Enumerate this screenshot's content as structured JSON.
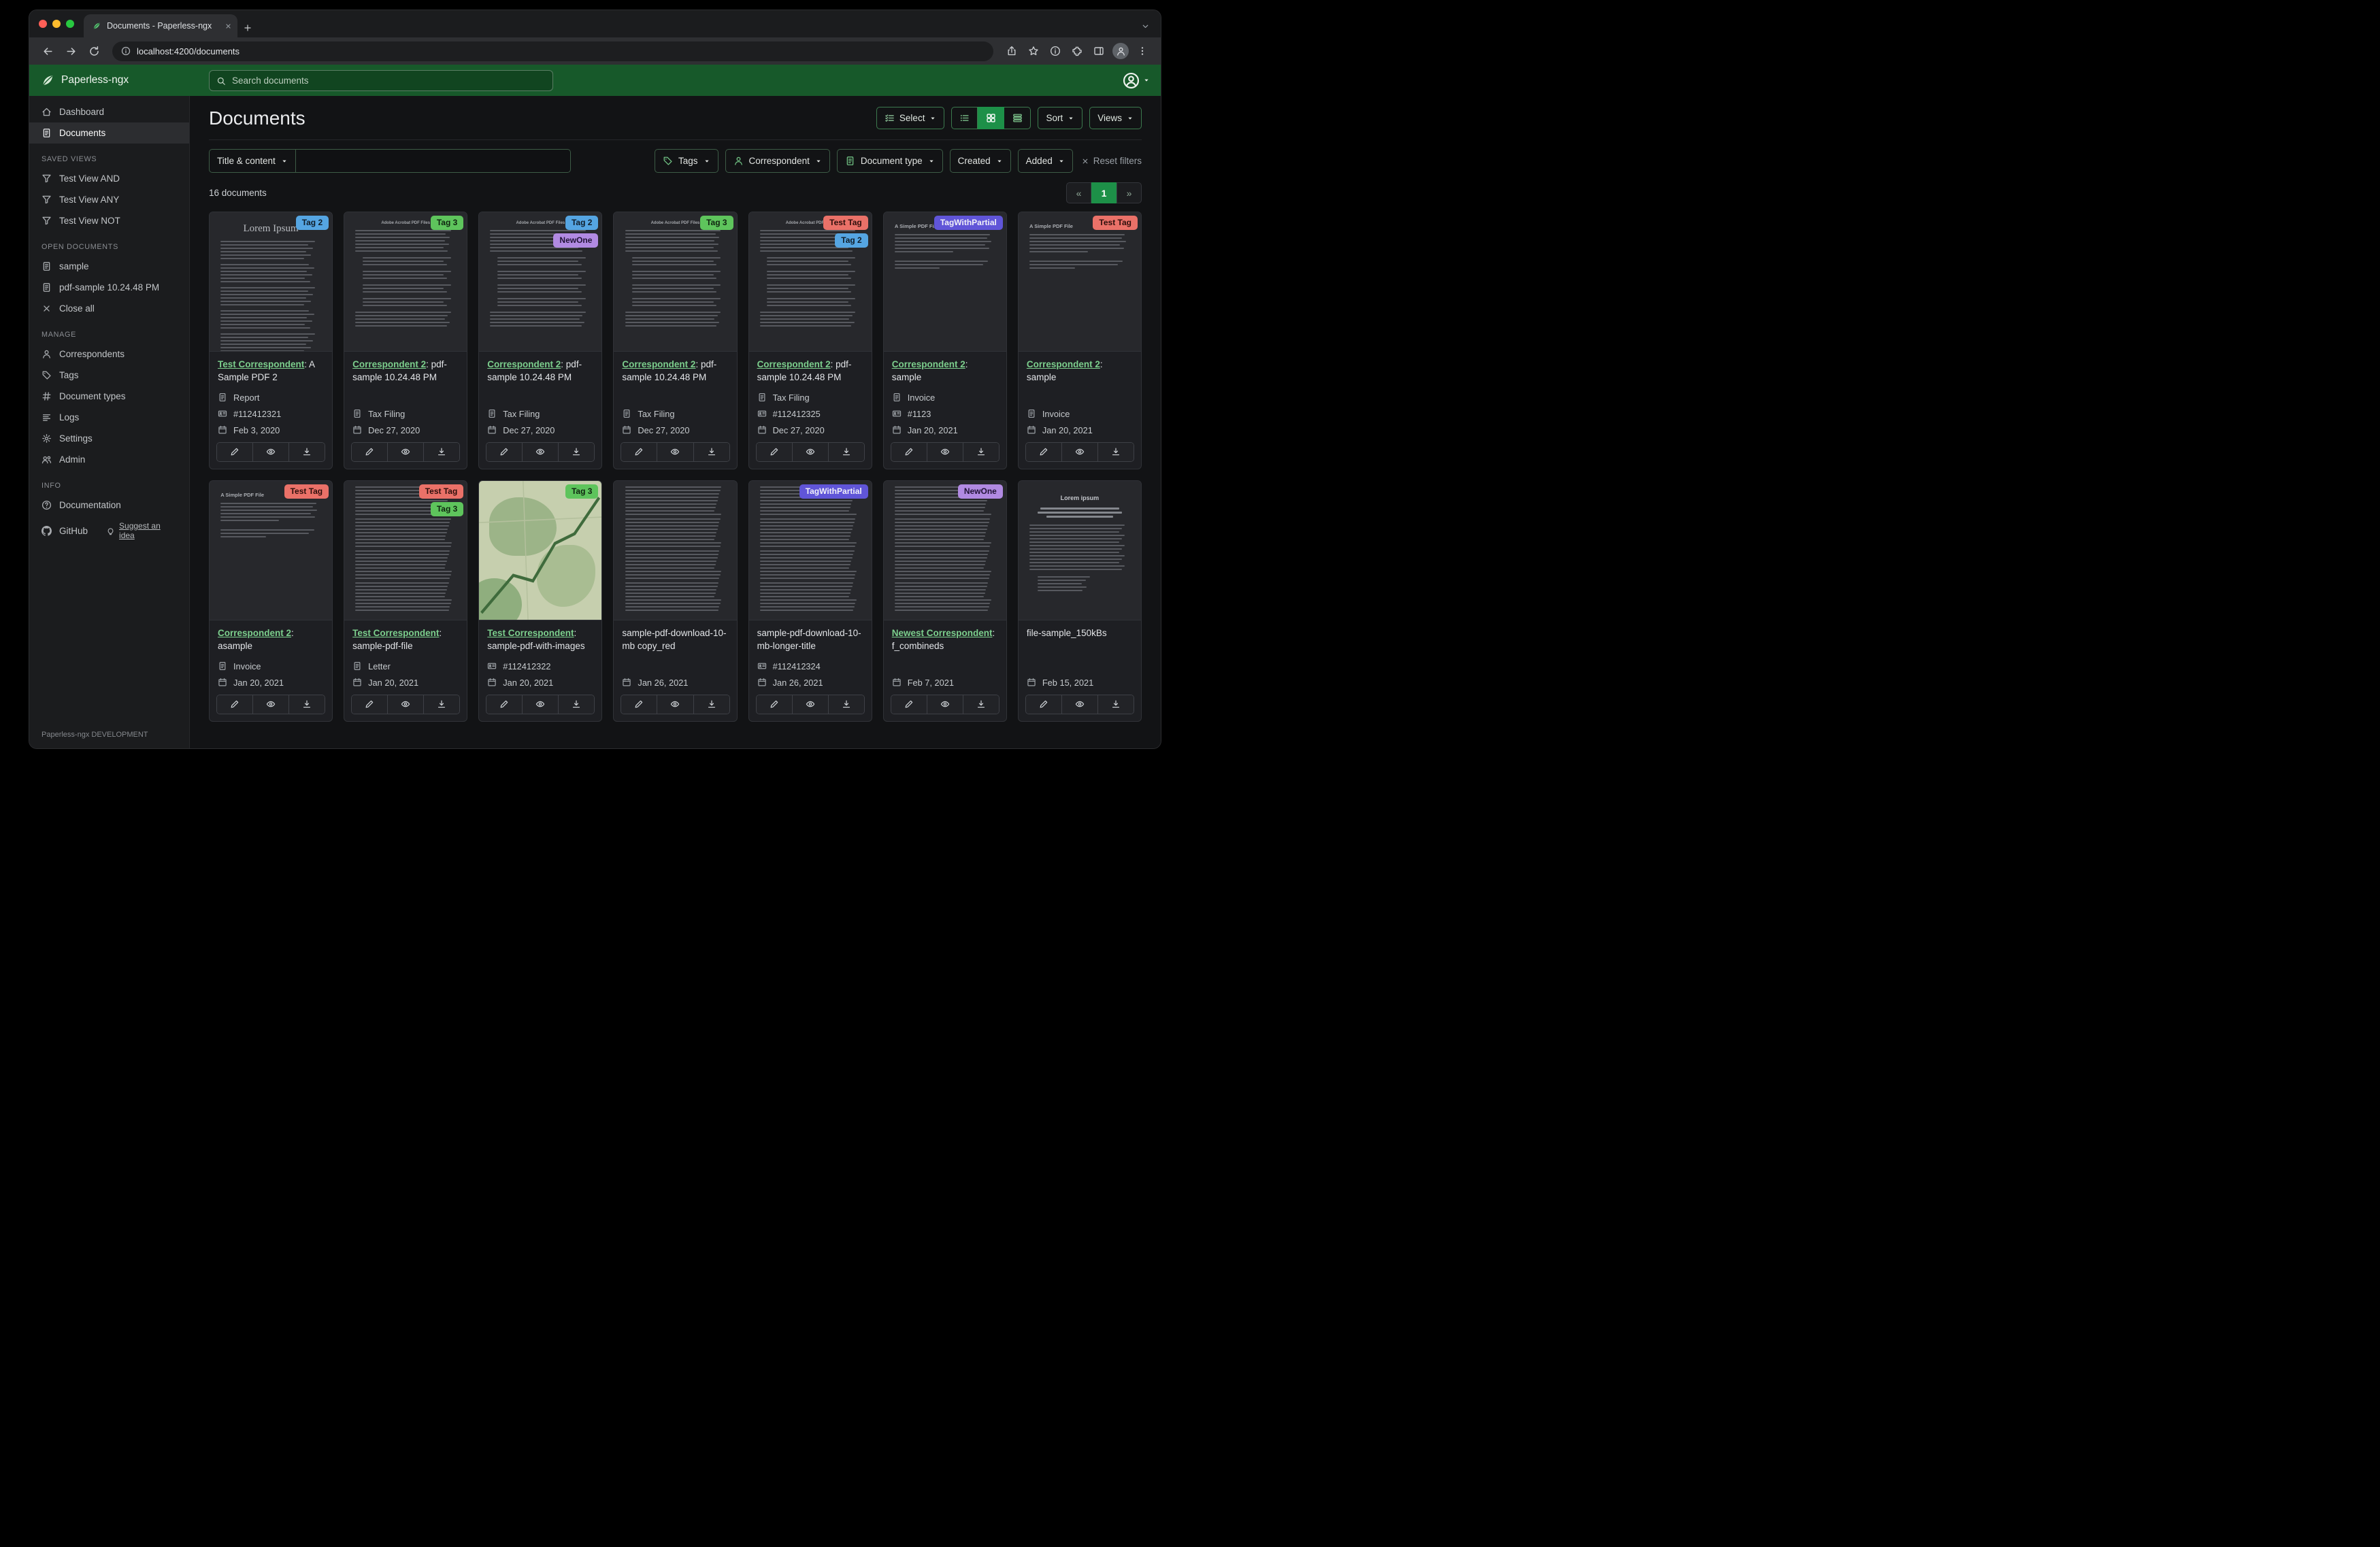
{
  "colors": {
    "header_green": "#17592a",
    "accent_green": "#1d9048",
    "link_green": "#7ccf8d",
    "main_bg": "#121315",
    "sidebar_bg": "#1b1c1e",
    "card_bg": "#1e1f23"
  },
  "browser": {
    "tab_title": "Documents - Paperless-ngx",
    "url": "localhost:4200/documents"
  },
  "header": {
    "brand": "Paperless-ngx",
    "search_placeholder": "Search documents"
  },
  "sidebar": {
    "sections": [
      {
        "items": [
          {
            "icon": "house",
            "label": "Dashboard"
          },
          {
            "icon": "doc",
            "label": "Documents",
            "active": true
          }
        ]
      },
      {
        "header": "SAVED VIEWS",
        "items": [
          {
            "icon": "funnel",
            "label": "Test View AND"
          },
          {
            "icon": "funnel",
            "label": "Test View ANY"
          },
          {
            "icon": "funnel",
            "label": "Test View NOT"
          }
        ]
      },
      {
        "header": "OPEN DOCUMENTS",
        "items": [
          {
            "icon": "doc",
            "label": "sample"
          },
          {
            "icon": "doc",
            "label": "pdf-sample 10.24.48 PM"
          },
          {
            "icon": "x",
            "label": "Close all"
          }
        ]
      },
      {
        "header": "MANAGE",
        "items": [
          {
            "icon": "person",
            "label": "Correspondents"
          },
          {
            "icon": "tag",
            "label": "Tags"
          },
          {
            "icon": "hash",
            "label": "Document types"
          },
          {
            "icon": "logs",
            "label": "Logs"
          },
          {
            "icon": "gear",
            "label": "Settings"
          },
          {
            "icon": "people",
            "label": "Admin"
          }
        ]
      },
      {
        "header": "INFO",
        "items": [
          {
            "icon": "question",
            "label": "Documentation"
          },
          {
            "icon": "github",
            "label": "GitHub",
            "suffix": {
              "icon": "bulb",
              "label": "Suggest an idea"
            }
          }
        ]
      }
    ],
    "footer": "Paperless-ngx DEVELOPMENT"
  },
  "page": {
    "title": "Documents",
    "select_label": "Select",
    "sort_label": "Sort",
    "views_label": "Views",
    "count_label": "16 documents",
    "pagination": {
      "prev": "«",
      "page": "1",
      "next": "»"
    }
  },
  "filters": {
    "title_content_label": "Title & content",
    "query_value": "",
    "buttons": [
      {
        "icon": "tag",
        "label": "Tags"
      },
      {
        "icon": "person",
        "label": "Correspondent"
      },
      {
        "icon": "doc",
        "label": "Document type"
      },
      {
        "label": "Created"
      },
      {
        "label": "Added"
      }
    ],
    "reset_label": "Reset filters"
  },
  "tag_colors": {
    "Tag 2": {
      "bg": "#55a5e2",
      "fg": "#101d29"
    },
    "Tag 3": {
      "bg": "#5ec45c",
      "fg": "#0f2410"
    },
    "NewOne": {
      "bg": "#b18ae2",
      "fg": "#201336"
    },
    "Test Tag": {
      "bg": "#ea7168",
      "fg": "#2d0f0c"
    },
    "TagWithPartial": {
      "bg": "#6055d8",
      "fg": "#f1f1f8"
    }
  },
  "card_actions": [
    "edit",
    "preview",
    "download"
  ],
  "cards": [
    {
      "tags": [
        "Tag 2"
      ],
      "thumb": {
        "variant": "title-doc",
        "heading": "Lorem Ipsum"
      },
      "link": "Test Correspondent",
      "rest": ": A Sample PDF 2",
      "type": "Report",
      "asn": "#112412321",
      "date": "Feb 3, 2020"
    },
    {
      "tags": [
        "Tag 3"
      ],
      "thumb": {
        "variant": "pdf-doc",
        "heading": "Adobe Acrobat PDF Files"
      },
      "link": "Correspondent 2",
      "rest": ": pdf-sample 10.24.48 PM",
      "type": "Tax Filing",
      "date": "Dec 27, 2020"
    },
    {
      "tags": [
        "Tag 2",
        "NewOne"
      ],
      "thumb": {
        "variant": "pdf-doc",
        "heading": "Adobe Acrobat PDF Files"
      },
      "link": "Correspondent 2",
      "rest": ": pdf-sample 10.24.48 PM",
      "type": "Tax Filing",
      "date": "Dec 27, 2020"
    },
    {
      "tags": [
        "Tag 3"
      ],
      "thumb": {
        "variant": "pdf-doc",
        "heading": "Adobe Acrobat PDF Files"
      },
      "link": "Correspondent 2",
      "rest": ": pdf-sample 10.24.48 PM",
      "type": "Tax Filing",
      "date": "Dec 27, 2020"
    },
    {
      "tags": [
        "Test Tag",
        "Tag 2"
      ],
      "thumb": {
        "variant": "pdf-doc",
        "heading": "Adobe Acrobat PDF Files"
      },
      "link": "Correspondent 2",
      "rest": ": pdf-sample 10.24.48 PM",
      "type": "Tax Filing",
      "asn": "#112412325",
      "date": "Dec 27, 2020"
    },
    {
      "tags": [
        "TagWithPartial"
      ],
      "thumb": {
        "variant": "simple-doc",
        "heading": "A Simple PDF File"
      },
      "link": "Correspondent 2",
      "rest": ": sample",
      "type": "Invoice",
      "asn": "#1123",
      "date": "Jan 20, 2021"
    },
    {
      "tags": [
        "Test Tag"
      ],
      "thumb": {
        "variant": "simple-doc",
        "heading": "A Simple PDF File"
      },
      "link": "Correspondent 2",
      "rest": ": sample",
      "type": "Invoice",
      "date": "Jan 20, 2021"
    },
    {
      "tags": [
        "Test Tag"
      ],
      "thumb": {
        "variant": "simple-doc",
        "heading": "A Simple PDF File"
      },
      "link": "Correspondent 2",
      "rest": ": asample",
      "type": "Invoice",
      "date": "Jan 20, 2021"
    },
    {
      "tags": [
        "Test Tag",
        "Tag 3"
      ],
      "thumb": {
        "variant": "dense-doc"
      },
      "link": "Test Correspondent",
      "rest": ": sample-pdf-file",
      "type": "Letter",
      "date": "Jan 20, 2021"
    },
    {
      "tags": [
        "Tag 3"
      ],
      "thumb": {
        "variant": "map"
      },
      "link": "Test Correspondent",
      "rest": ": sample-pdf-with-images",
      "asn": "#112412322",
      "date": "Jan 20, 2021"
    },
    {
      "tags": [],
      "thumb": {
        "variant": "dense-doc"
      },
      "rest": "sample-pdf-download-10-mb copy_red",
      "date": "Jan 26, 2021"
    },
    {
      "tags": [
        "TagWithPartial"
      ],
      "thumb": {
        "variant": "dense-doc"
      },
      "rest": "sample-pdf-download-10-mb-longer-title",
      "asn": "#112412324",
      "date": "Jan 26, 2021"
    },
    {
      "tags": [
        "NewOne"
      ],
      "thumb": {
        "variant": "dense-doc"
      },
      "link": "Newest Correspondent",
      "rest": ": f_combineds",
      "date": "Feb 7, 2021"
    },
    {
      "tags": [],
      "thumb": {
        "variant": "center-doc",
        "heading": "Lorem ipsum"
      },
      "rest": "file-sample_150kBs",
      "date": "Feb 15, 2021"
    }
  ]
}
